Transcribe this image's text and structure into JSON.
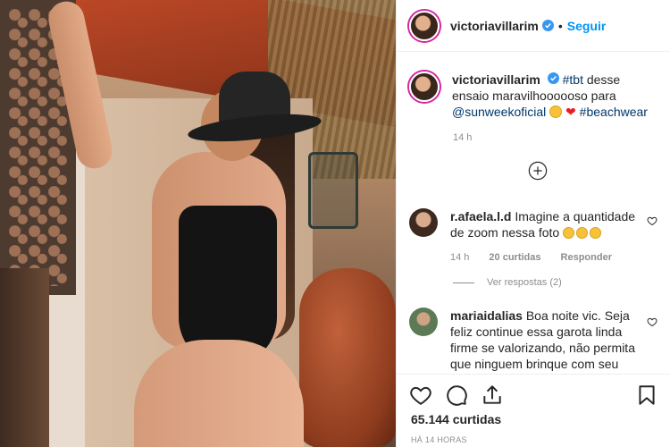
{
  "post": {
    "username": "victoriavillarim",
    "follow_label": "Seguir",
    "dot": "•",
    "caption_parts": {
      "hashtag1": "#tbt",
      "text": " desse ensaio maravilhoooooso para ",
      "mention": "@sunweekoficial",
      "hashtag2": "#beachwear"
    },
    "time": "14 h",
    "likes": "65.144 curtidas",
    "ago": "HÁ 14 HORAS",
    "colors": {
      "accent": "#0095f6",
      "link": "#00376b",
      "muted": "#8e8e8e"
    }
  },
  "comments": [
    {
      "username": "r.afaela.l.d",
      "text": "Imagine a quantidade de zoom nessa foto",
      "time": "14 h",
      "likes": "20 curtidas",
      "reply": "Responder",
      "view_replies": "Ver respostas (2)"
    },
    {
      "username": "mariaidalias",
      "text": "Boa noite vic. Seja feliz continue essa garota linda firme se valorizando, não permita que ninguem brinque com seu"
    }
  ],
  "icons": [
    "verified-badge-icon",
    "add-comments-icon",
    "like-heart-icon",
    "comment-icon",
    "share-icon",
    "bookmark-icon",
    "comment-like-icon"
  ]
}
